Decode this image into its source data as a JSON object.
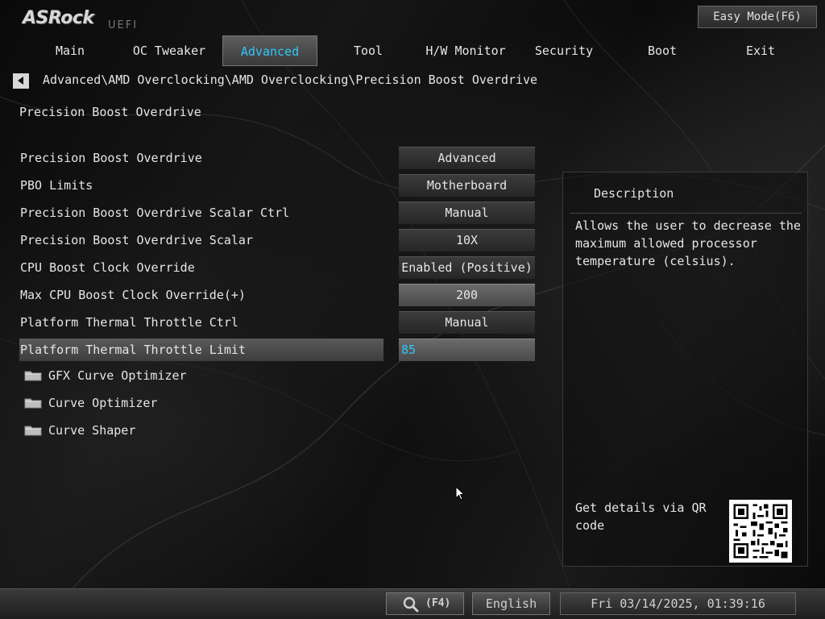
{
  "brand": {
    "logo": "ASRock",
    "sub": "UEFI"
  },
  "easy_mode": "Easy Mode(F6)",
  "tabs": [
    {
      "label": "Main",
      "active": false
    },
    {
      "label": "OC Tweaker",
      "active": false
    },
    {
      "label": "Advanced",
      "active": true
    },
    {
      "label": "Tool",
      "active": false
    },
    {
      "label": "H/W Monitor",
      "active": false
    },
    {
      "label": "Security",
      "active": false
    },
    {
      "label": "Boot",
      "active": false
    },
    {
      "label": "Exit",
      "active": false
    }
  ],
  "breadcrumb": "Advanced\\AMD Overclocking\\AMD Overclocking\\Precision Boost Overdrive",
  "page_title": "Precision Boost Overdrive",
  "settings": [
    {
      "label": "Precision Boost Overdrive",
      "value": "Advanced"
    },
    {
      "label": "PBO Limits",
      "value": "Motherboard"
    },
    {
      "label": "Precision Boost Overdrive Scalar Ctrl",
      "value": "Manual"
    },
    {
      "label": "Precision Boost Overdrive Scalar",
      "value": "10X"
    },
    {
      "label": "CPU Boost Clock Override",
      "value": "Enabled (Positive)"
    },
    {
      "label": "Max CPU Boost Clock Override(+)",
      "value": "200"
    },
    {
      "label": "Platform Thermal Throttle Ctrl",
      "value": "Manual"
    },
    {
      "label": "Platform Thermal Throttle Limit",
      "value": "85"
    }
  ],
  "folders": [
    {
      "label": "GFX Curve Optimizer"
    },
    {
      "label": "Curve Optimizer"
    },
    {
      "label": "Curve Shaper"
    }
  ],
  "description": {
    "title": "Description",
    "text": "Allows the user to decrease the maximum allowed processor temperature (celsius).",
    "qr_text": "Get details via QR code"
  },
  "bottom": {
    "search_key": "(F4)",
    "language": "English",
    "datetime": "Fri 03/14/2025, 01:39:16"
  },
  "colors": {
    "accent": "#2ec8ff",
    "panel": "#2a2a2a"
  }
}
